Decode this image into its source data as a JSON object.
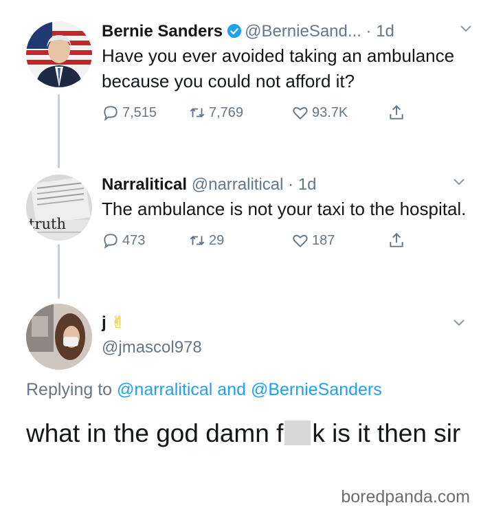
{
  "tweets": [
    {
      "name": "Bernie Sanders",
      "handle": "@BernieSand...",
      "time": "· 1d",
      "text": "Have you ever avoided taking an ambulance because you could not afford it?",
      "replies": "7,515",
      "retweets": "7,769",
      "likes": "93.7K"
    },
    {
      "name": "Narralitical",
      "handle": "@narralitical",
      "time": "· 1d",
      "avatar_word": "truth",
      "text": "The ambulance is not your taxi to the hospital.",
      "replies": "473",
      "retweets": "29",
      "likes": "187"
    },
    {
      "name": "j",
      "name_emoji": "✌",
      "handle": "@jmascol978",
      "replying_prefix": "Replying to",
      "replying_mention1": "@narralitical",
      "replying_and": "and",
      "replying_mention2": "@BernieSanders",
      "text_before": "what in the god damn f",
      "text_after": "k is it then sir"
    }
  ],
  "watermark": "boredpanda.com",
  "colors": {
    "link": "#1da1f2",
    "muted": "#657786",
    "verified": "#1da1f2"
  },
  "icons": [
    "reply-icon",
    "retweet-icon",
    "like-icon",
    "share-icon",
    "verified-icon",
    "chevron-down-icon"
  ]
}
